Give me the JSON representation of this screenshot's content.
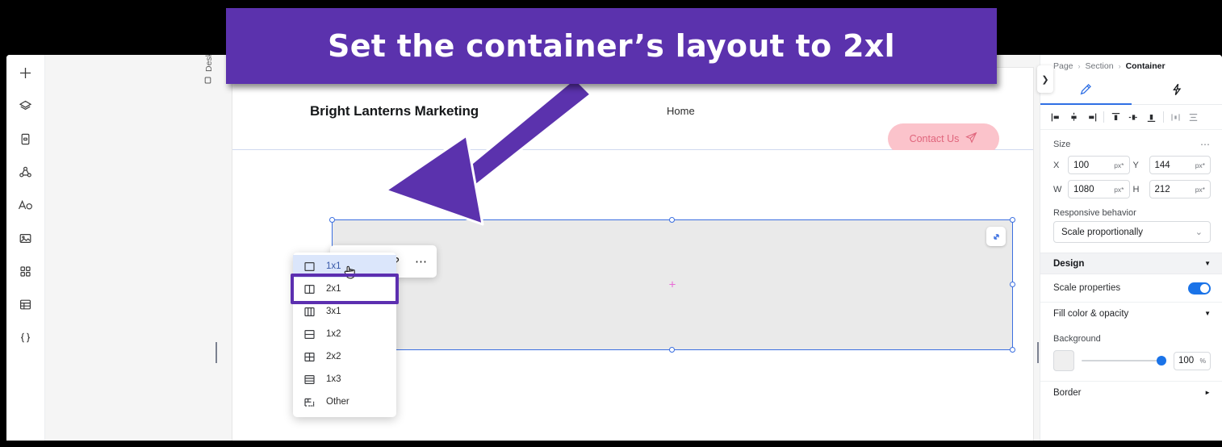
{
  "annotation": {
    "banner_text": "Set the container’s layout to 2xl",
    "banner_color": "#5b32ad"
  },
  "left_rail": {
    "items": [
      {
        "name": "add-icon",
        "label": "Add"
      },
      {
        "name": "layers-icon",
        "label": "Layers"
      },
      {
        "name": "pages-icon",
        "label": "Pages"
      },
      {
        "name": "data-icon",
        "label": "Data"
      },
      {
        "name": "text-icon",
        "label": "Text"
      },
      {
        "name": "media-icon",
        "label": "Media"
      },
      {
        "name": "components-icon",
        "label": "Components"
      },
      {
        "name": "table-icon",
        "label": "Table"
      },
      {
        "name": "code-icon",
        "label": "Code"
      }
    ]
  },
  "workspace": {
    "device_label": "Desktop (Primary)"
  },
  "canvas": {
    "brand": "Bright Lanterns Marketing",
    "nav": [
      "Home"
    ],
    "cta": {
      "label": "Contact Us",
      "icon": "send-icon",
      "bg": "#fbc3cb",
      "fg": "#e0657c"
    }
  },
  "context_toolbar": {
    "items": [
      {
        "name": "layout-button",
        "glyph": "▣"
      },
      {
        "name": "comment-button",
        "glyph": "▭"
      },
      {
        "name": "help-button",
        "glyph": "?"
      },
      {
        "name": "more-button",
        "glyph": "⋯"
      }
    ]
  },
  "layout_menu": {
    "items": [
      {
        "label": "1x1",
        "icon": "grid-1x1-icon",
        "state": "hovered"
      },
      {
        "label": "2x1",
        "icon": "grid-2x1-icon",
        "state": "highlighted"
      },
      {
        "label": "3x1",
        "icon": "grid-3x1-icon",
        "state": "normal"
      },
      {
        "label": "1x2",
        "icon": "grid-1x2-icon",
        "state": "normal"
      },
      {
        "label": "2x2",
        "icon": "grid-2x2-icon",
        "state": "normal"
      },
      {
        "label": "1x3",
        "icon": "grid-1x3-icon",
        "state": "normal"
      },
      {
        "label": "Other",
        "icon": "grid-other-icon",
        "state": "normal"
      }
    ],
    "highlight_color": "#5c2fb0"
  },
  "right_panel": {
    "breadcrumb": {
      "items": [
        "Page",
        "Section",
        "Container"
      ],
      "separator": "›"
    },
    "tabs": [
      {
        "name": "tab-design",
        "icon": "brush-icon",
        "active": true
      },
      {
        "name": "tab-interactions",
        "icon": "lightning-icon",
        "active": false
      }
    ],
    "align_buttons": [
      "align-left-icon",
      "align-center-horizontal-icon",
      "align-right-icon",
      "align-top-icon",
      "align-middle-icon",
      "align-bottom-icon",
      "distribute-horizontal-icon",
      "distribute-vertical-icon"
    ],
    "size": {
      "title": "Size",
      "more": "⋯",
      "fields": [
        {
          "label": "X",
          "value": "100",
          "unit": "px*"
        },
        {
          "label": "Y",
          "value": "144",
          "unit": "px*"
        },
        {
          "label": "W",
          "value": "1080",
          "unit": "px*"
        },
        {
          "label": "H",
          "value": "212",
          "unit": "px*"
        }
      ]
    },
    "responsive": {
      "label": "Responsive behavior",
      "value": "Scale proportionally",
      "caret": "⌄"
    },
    "design": {
      "title": "Design",
      "caret": "▼",
      "scale_properties": {
        "label": "Scale properties",
        "on": true
      }
    },
    "fill": {
      "title": "Fill color & opacity",
      "caret": "▼",
      "background_label": "Background",
      "opacity_value": "100",
      "opacity_unit": "%",
      "swatch_color": "#efefef"
    },
    "border": {
      "title": "Border",
      "caret": "►"
    }
  }
}
